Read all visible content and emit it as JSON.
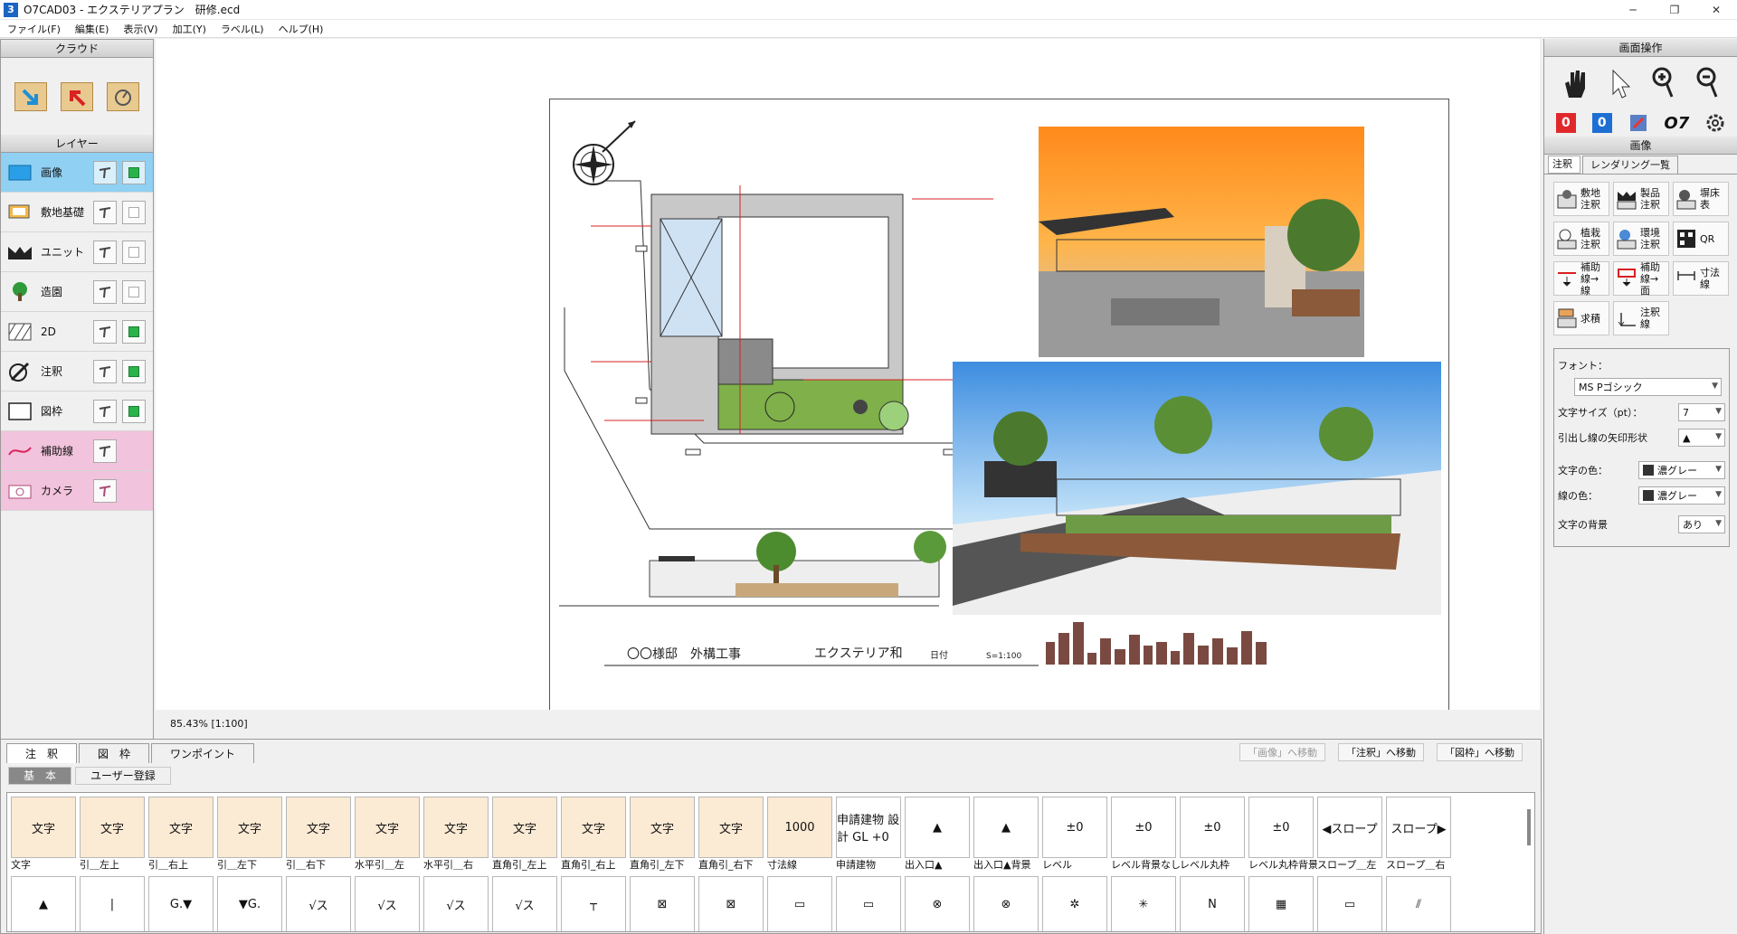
{
  "window": {
    "title": "O7CAD03 - エクステリアプラン　研修.ecd",
    "app_icon": "3",
    "controls": [
      "─",
      "❐",
      "✕"
    ]
  },
  "menu": [
    "ファイル(F)",
    "編集(E)",
    "表示(V)",
    "加工(Y)",
    "ラベル(L)",
    "ヘルプ(H)"
  ],
  "left": {
    "cloud_header": "クラウド",
    "layer_header": "レイヤー",
    "layers": [
      {
        "name": "画像"
      },
      {
        "name": "敷地基礎"
      },
      {
        "name": "ユニット"
      },
      {
        "name": "造園"
      },
      {
        "name": "2D"
      },
      {
        "name": "注釈"
      },
      {
        "name": "図枠"
      },
      {
        "name": "補助線"
      },
      {
        "name": "カメラ"
      }
    ]
  },
  "sheet": {
    "title_block": {
      "client": "〇〇様邸　外構工事",
      "company": "エクステリア和",
      "date_label": "日付",
      "scale": "S=1:100"
    }
  },
  "status": {
    "zoom": "85.43% [1:100]"
  },
  "right": {
    "view_header": "画面操作",
    "image_header": "画像",
    "badge_red": "0",
    "badge_blue": "0",
    "logo": "O7",
    "tabs": [
      "注釈",
      "レンダリング一覧"
    ],
    "annotation_buttons": [
      {
        "label": "敷地注釈"
      },
      {
        "label": "製品注釈"
      },
      {
        "label": "塀床表"
      },
      {
        "label": "植栽注釈"
      },
      {
        "label": "環境注釈"
      },
      {
        "label": "QR"
      },
      {
        "label": "補助線→線"
      },
      {
        "label": "補助線→面"
      },
      {
        "label": "寸法線"
      },
      {
        "label": "求積"
      },
      {
        "label": "注釈線"
      }
    ],
    "font_settings": {
      "font_label": "フォント：",
      "font_value": "MS Pゴシック",
      "size_label": "文字サイズ（pt）：",
      "size_value": "7",
      "arrow_label": "引出し線の矢印形状",
      "arrow_value": "▲",
      "text_color_label": "文字の色：",
      "text_color_value": "濃グレー",
      "line_color_label": "線の色：",
      "line_color_value": "濃グレー",
      "bg_label": "文字の背景",
      "bg_value": "あり"
    }
  },
  "bottom": {
    "tabs": [
      "注　釈",
      "図　枠",
      "ワンポイント"
    ],
    "move_buttons": [
      "「画像」へ移動",
      "「注釈」へ移動",
      "「図枠」へ移動"
    ],
    "subtabs": [
      "基　本",
      "ユーザー登録"
    ],
    "symbols_row1": [
      {
        "label": "文字",
        "glyph": "文字"
      },
      {
        "label": "引＿左上",
        "glyph": "文字"
      },
      {
        "label": "引＿右上",
        "glyph": "文字"
      },
      {
        "label": "引＿左下",
        "glyph": "文字"
      },
      {
        "label": "引＿右下",
        "glyph": "文字"
      },
      {
        "label": "水平引＿左",
        "glyph": "文字"
      },
      {
        "label": "水平引＿右",
        "glyph": "文字"
      },
      {
        "label": "直角引_左上",
        "glyph": "文字"
      },
      {
        "label": "直角引_右上",
        "glyph": "文字"
      },
      {
        "label": "直角引_左下",
        "glyph": "文字"
      },
      {
        "label": "直角引_右下",
        "glyph": "文字"
      },
      {
        "label": "寸法線",
        "glyph": "1000"
      },
      {
        "label": "申請建物",
        "glyph": "申請建物 設計 GL +0"
      },
      {
        "label": "出入口▲",
        "glyph": "▲"
      },
      {
        "label": "出入口▲背景",
        "glyph": "▲"
      },
      {
        "label": "レベル",
        "glyph": "±0"
      },
      {
        "label": "レベル背景なし",
        "glyph": "±0"
      },
      {
        "label": "レベル丸枠",
        "glyph": "±0"
      },
      {
        "label": "レベル丸枠背景",
        "glyph": "±0"
      },
      {
        "label": "スロープ＿左",
        "glyph": "◀スロープ"
      },
      {
        "label": "スロープ＿右",
        "glyph": "スロープ▶"
      }
    ],
    "symbols_row2": [
      {
        "glyph": "▲"
      },
      {
        "glyph": "|"
      },
      {
        "glyph": "G.▼"
      },
      {
        "glyph": "▼G."
      },
      {
        "glyph": "√ス"
      },
      {
        "glyph": "√ス"
      },
      {
        "glyph": "√ス"
      },
      {
        "glyph": "√ス"
      },
      {
        "glyph": "┬"
      },
      {
        "glyph": "⊠"
      },
      {
        "glyph": "⊠"
      },
      {
        "glyph": "▭"
      },
      {
        "glyph": "▭"
      },
      {
        "glyph": "⊗"
      },
      {
        "glyph": "⊗"
      },
      {
        "glyph": "✲"
      },
      {
        "glyph": "✳"
      },
      {
        "glyph": "N"
      },
      {
        "glyph": "▦"
      },
      {
        "glyph": "▭"
      },
      {
        "glyph": "⫽"
      }
    ]
  },
  "colors": {
    "layer_active": "#8fd0f3",
    "layer_pink": "#f2c3dc",
    "symbol_bg": "#fbead4"
  }
}
